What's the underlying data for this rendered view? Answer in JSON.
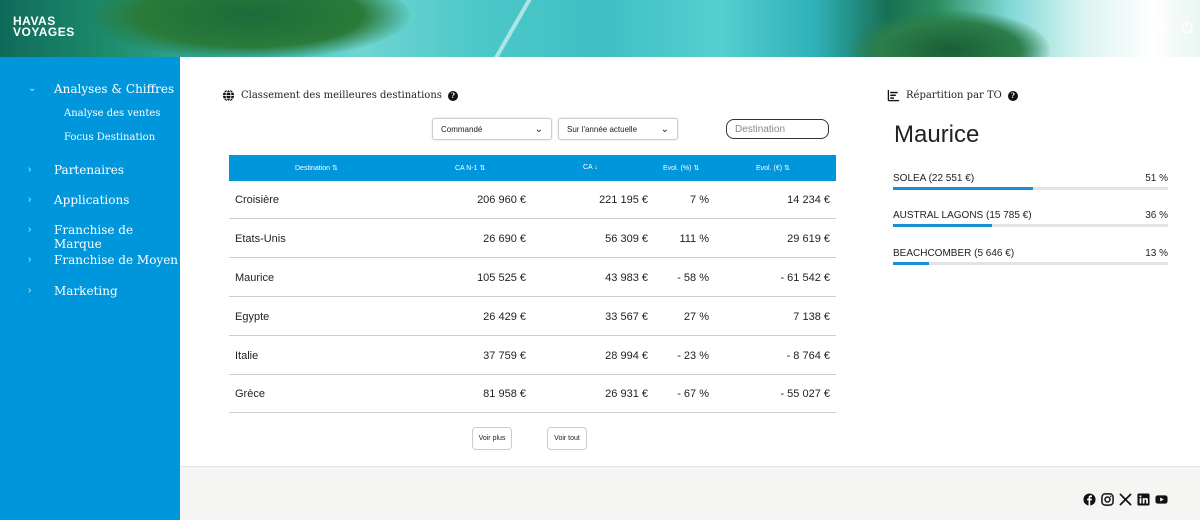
{
  "brand": {
    "line1": "HAVAS",
    "line2": "VOYAGES"
  },
  "header_icons": [
    "user-icon",
    "power-icon"
  ],
  "sidebar": {
    "items": [
      {
        "label": "Analyses & Chiffres",
        "expanded": true,
        "children": [
          "Analyse des ventes",
          "Focus Destination"
        ]
      },
      {
        "label": "Partenaires"
      },
      {
        "label": "Applications"
      },
      {
        "label": "Franchise de Marque"
      },
      {
        "label": "Franchise de Moyen"
      },
      {
        "label": "Marketing"
      }
    ]
  },
  "ranking": {
    "title": "Classement des meilleures destinations",
    "filter_type": "Commandé",
    "filter_period": "Sur l'année actuelle",
    "search_placeholder": "Destination",
    "columns": [
      "Destination ⇅",
      "CA N-1 ⇅",
      "CA ↓",
      "Evol. (%) ⇅",
      "Evol. (€) ⇅"
    ],
    "rows": [
      [
        "Croisière",
        "206 960 €",
        "221 195 €",
        "7 %",
        "14 234 €"
      ],
      [
        "Etats-Unis",
        "26 690 €",
        "56 309 €",
        "111 %",
        "29 619 €"
      ],
      [
        "Maurice",
        "105 525 €",
        "43 983 €",
        "- 58 %",
        "- 61 542 €"
      ],
      [
        "Egypte",
        "26 429 €",
        "33 567 €",
        "27 %",
        "7 138 €"
      ],
      [
        "Italie",
        "37 759 €",
        "28 994 €",
        "- 23 %",
        "- 8 764 €"
      ],
      [
        "Grèce",
        "81 958 €",
        "26 931 €",
        "- 67 %",
        "- 55 027 €"
      ]
    ],
    "more_label": "Voir plus",
    "all_label": "Voir tout"
  },
  "repartition": {
    "title": "Répartition par TO",
    "destination": "Maurice",
    "items": [
      {
        "label": "SOLEA (22 551 €)",
        "percent_label": "51 %",
        "percent": 51
      },
      {
        "label": "AUSTRAL LAGONS (15 785 €)",
        "percent_label": "36 %",
        "percent": 36
      },
      {
        "label": "BEACHCOMBER (5 646 €)",
        "percent_label": "13 %",
        "percent": 13
      }
    ]
  },
  "footer": {
    "social_icons": [
      "facebook-icon",
      "instagram-icon",
      "x-icon",
      "linkedin-icon",
      "youtube-icon"
    ]
  },
  "colors": {
    "primary": "#0096dc",
    "bar": "#1b8fd6",
    "footer_bg": "#f5f5f3"
  }
}
